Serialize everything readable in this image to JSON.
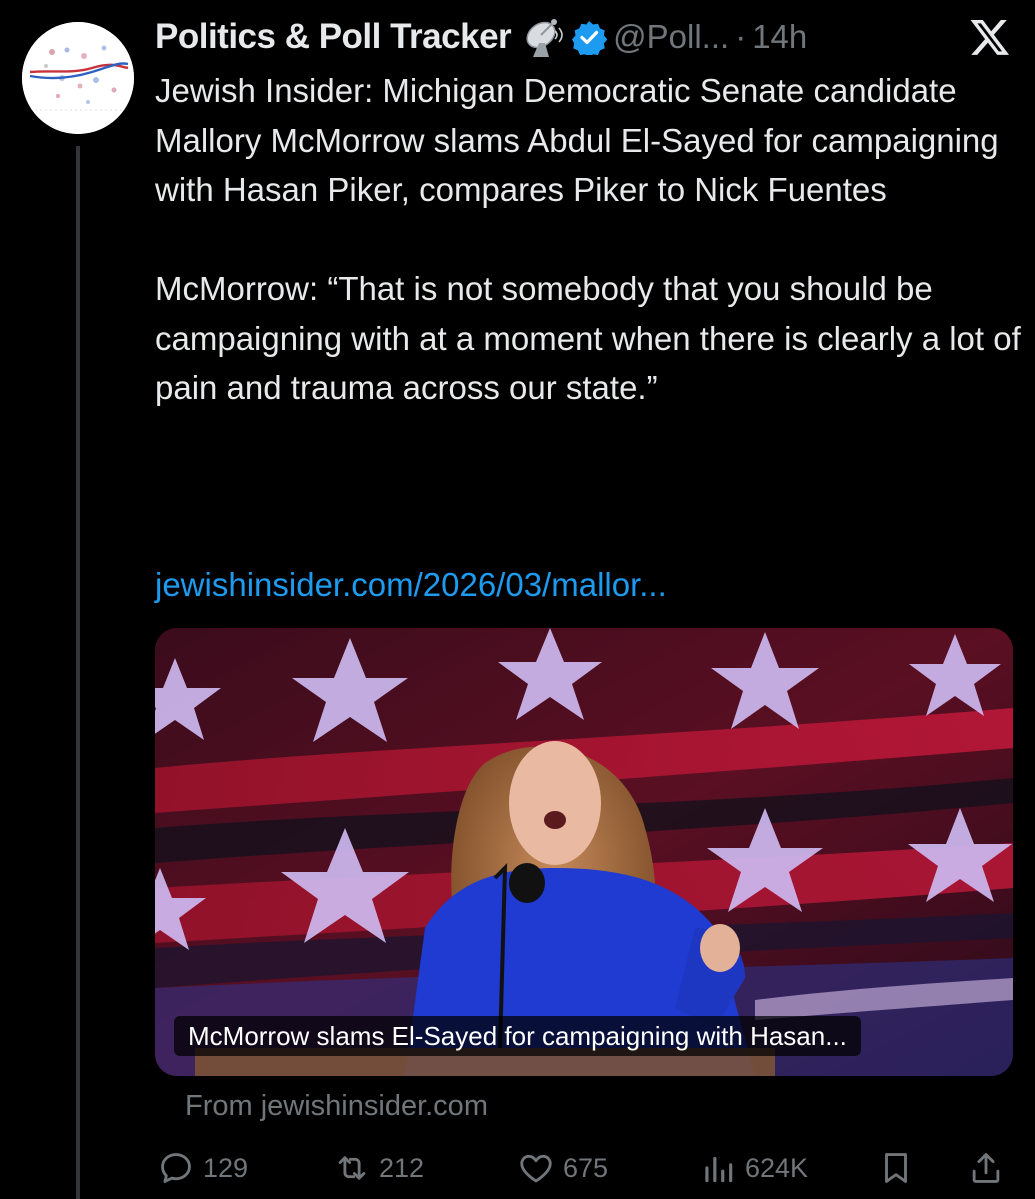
{
  "account": {
    "name": "Politics & Poll Tracker",
    "emoji_icon": "satellite-dish-icon",
    "verified_icon": "verified-badge-icon",
    "handle": "@Poll...",
    "separator": "·",
    "time": "14h"
  },
  "tweet": {
    "paragraph1": "Jewish Insider: Michigan Democratic Senate candidate Mallory McMorrow slams Abdul El-Sayed for campaigning with Hasan Piker, compares Piker to Nick Fuentes",
    "paragraph2": "McMorrow: “That is not somebody that you should be campaigning with at a moment when there is clearly a lot of pain and trauma across our state.”",
    "link": "jewishinsider.com/2026/03/mallor..."
  },
  "card": {
    "caption": "McMorrow slams El-Sayed for campaigning with Hasan...",
    "source": "From jewishinsider.com"
  },
  "actions": {
    "replies": "129",
    "reposts": "212",
    "likes": "675",
    "views": "624K"
  },
  "colors": {
    "background": "#000000",
    "text": "#e7e9ea",
    "muted": "#71767b",
    "link": "#1d9bf0",
    "verified": "#1d9bf0"
  }
}
